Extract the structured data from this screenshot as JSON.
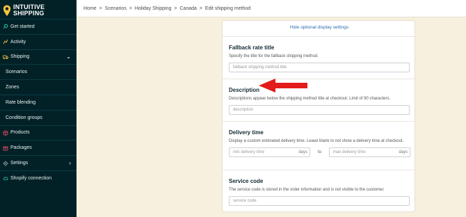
{
  "app": {
    "logo_line1": "INTUITIVE",
    "logo_line2": "SHIPPING"
  },
  "sidebar": {
    "items": [
      {
        "label": "Get started",
        "icon": "rocket-icon",
        "color": "#2ec4b6"
      },
      {
        "label": "Activity",
        "icon": "activity-icon",
        "color": "#f6c23e"
      },
      {
        "label": "Shipping",
        "icon": "truck-icon",
        "color": "#f6c23e"
      },
      {
        "label": "Scenarios"
      },
      {
        "label": "Zones"
      },
      {
        "label": "Rate blending"
      },
      {
        "label": "Condition groups"
      },
      {
        "label": "Products",
        "icon": "box-icon",
        "color": "#e74a6b"
      },
      {
        "label": "Packages",
        "icon": "package-icon",
        "color": "#e74a6b"
      },
      {
        "label": "Settings",
        "icon": "gear-icon",
        "color": "#9aa"
      },
      {
        "label": "Shopify connection",
        "icon": "cloud-icon",
        "color": "#2ec4b6"
      }
    ]
  },
  "breadcrumb": [
    "Home",
    ">",
    "Scenarios",
    ">",
    "Holiday Shipping",
    ">",
    "Canada",
    ">",
    "Edit shipping method"
  ],
  "card": {
    "toggle_link": "Hide optional display settings",
    "fallback": {
      "title": "Fallback rate title",
      "help": "Specify the title for the fallback shipping method.",
      "placeholder": "fallback shipping method title"
    },
    "description": {
      "title": "Description",
      "help": "Descriptions appear below the shipping method title at checkout. Limit of 90 characters.",
      "placeholder": "description"
    },
    "delivery": {
      "title": "Delivery time",
      "help": "Display a custom estimated delivery time. Leave blank to not show a delivery time at checkout.",
      "min_placeholder": "min delivery time",
      "max_placeholder": "max delivery time",
      "unit": "days",
      "to": "to"
    },
    "service": {
      "title": "Service code",
      "help": "The service code is stored in the order information and is not visible to the customer.",
      "placeholder": "service code"
    }
  },
  "colors": {
    "sidebar_bg": "#022127",
    "page_bg": "#f8f0de",
    "link": "#2b6cb0",
    "arrow": "#e31b1b",
    "logo_pin": "#f6c23e"
  }
}
